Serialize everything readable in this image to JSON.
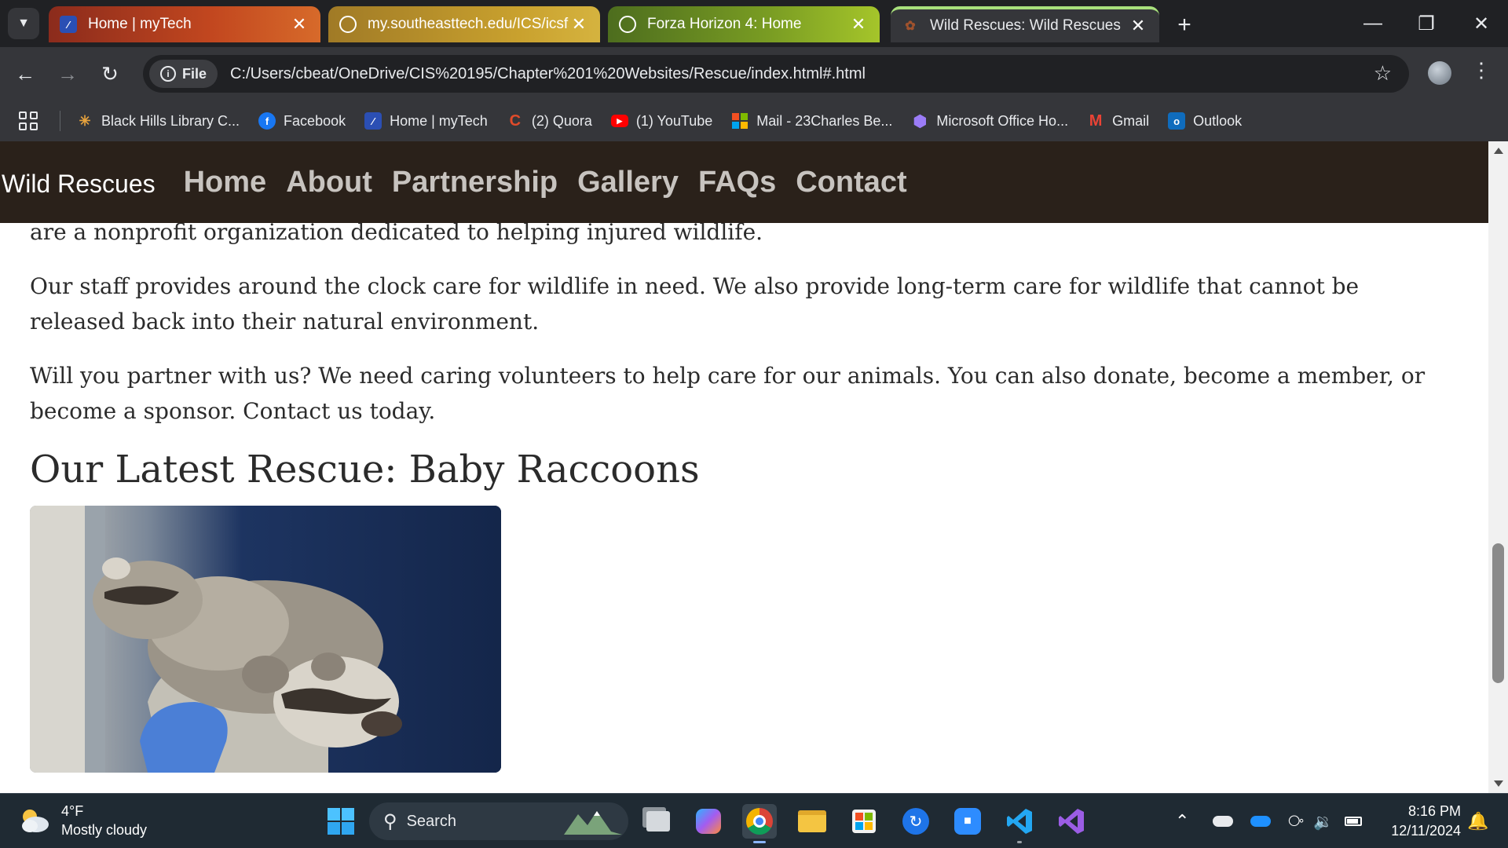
{
  "browser": {
    "tabs": [
      {
        "title": "Home | myTech"
      },
      {
        "title": "my.southeasttech.edu/ICS/icsfs/"
      },
      {
        "title": "Forza Horizon 4: Home"
      },
      {
        "title": "Wild Rescues: Wild Rescues"
      }
    ],
    "omnibox": {
      "chip_label": "File",
      "url": "C:/Users/cbeat/OneDrive/CIS%20195/Chapter%201%20Websites/Rescue/index.html#.html"
    },
    "bookmarks": [
      {
        "label": "Black Hills Library C...",
        "icon": "library-icon"
      },
      {
        "label": "Facebook",
        "icon": "facebook-icon"
      },
      {
        "label": "Home | myTech",
        "icon": "mytech-icon"
      },
      {
        "label": "(2) Quora",
        "icon": "quora-icon"
      },
      {
        "label": "(1) YouTube",
        "icon": "youtube-icon"
      },
      {
        "label": "Mail - 23Charles Be...",
        "icon": "microsoft-mail-icon"
      },
      {
        "label": "Microsoft Office Ho...",
        "icon": "office-icon"
      },
      {
        "label": "Gmail",
        "icon": "gmail-icon"
      },
      {
        "label": "Outlook",
        "icon": "outlook-icon"
      }
    ]
  },
  "site": {
    "brand": "Wild Rescues",
    "nav": [
      "Home",
      "About",
      "Partnership",
      "Gallery",
      "FAQs",
      "Contact"
    ],
    "paragraphs": [
      "Welcome to Wild Rescues. Our mission is to rescue, rehabilitate, and release wildlife back into their natural environment. We are a nonprofit organization dedicated to helping injured wildlife.",
      "Our staff provides around the clock care for wildlife in need. We also provide long-term care for wildlife that cannot be released back into their natural environment.",
      "Will you partner with us? We need caring volunteers to help care for our animals. You can also donate, become a member, or become a sponsor. Contact us today."
    ],
    "latest_heading": "Our Latest Rescue: Baby Raccoons",
    "colors": {
      "nav_bg": "#2a211a",
      "nav_link": "#c7c3bf",
      "text": "#2b2b2b"
    }
  },
  "taskbar": {
    "weather": {
      "temp": "4°F",
      "condition": "Mostly cloudy"
    },
    "search_placeholder": "Search",
    "clock": {
      "time": "8:16 PM",
      "date": "12/11/2024"
    }
  }
}
